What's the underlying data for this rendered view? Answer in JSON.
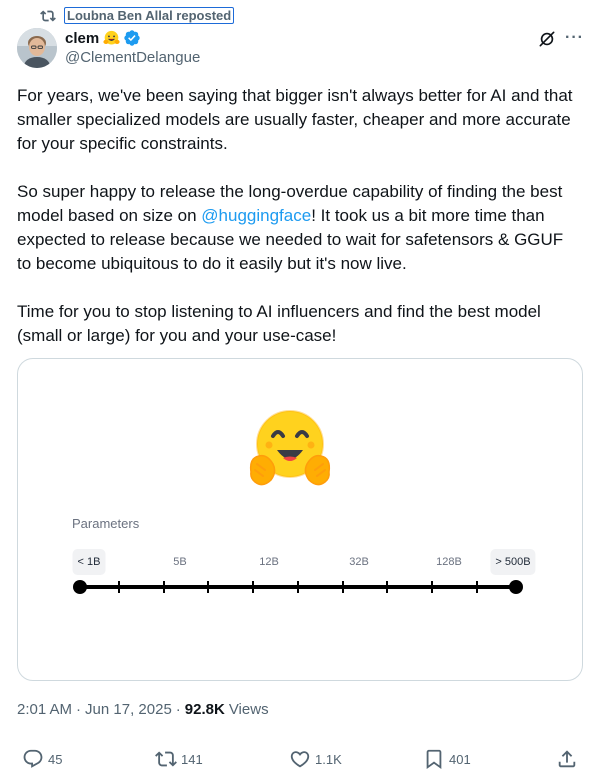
{
  "repost": {
    "label": "Loubna Ben Allal reposted"
  },
  "author": {
    "display_name": "clem",
    "handle": "@ClementDelangue",
    "verified": true
  },
  "tweet": {
    "para1": "For years, we've been saying that bigger isn't always better for AI and that smaller specialized models are usually faster, cheaper and more accurate for your specific constraints.",
    "para2_before": "So super happy to release the long-overdue capability of finding the best model based on size on ",
    "para2_mention": "@huggingface",
    "para2_after": "! It took us a bit more time than expected to release because we needed to wait for safetensors & GGUF to become ubiquitous to do it easily but it's now live.",
    "para3": "Time for you to stop listening to AI influencers and find the best model (small or large) for you and your use-case!"
  },
  "media": {
    "parameters_label": "Parameters",
    "ticks": [
      "< 1B",
      "5B",
      "12B",
      "32B",
      "128B",
      "> 500B"
    ],
    "range_min": "< 1B",
    "range_max": "> 500B"
  },
  "meta": {
    "time": "2:01 AM",
    "date": "Jun 17, 2025",
    "views_count": "92.8K",
    "views_label": "Views"
  },
  "actions": {
    "replies": "45",
    "reposts": "141",
    "likes": "1.1K",
    "bookmarks": "401"
  },
  "colors": {
    "link": "#1d9bf0",
    "verified": "#1d9bf0",
    "text_secondary": "#536471"
  }
}
